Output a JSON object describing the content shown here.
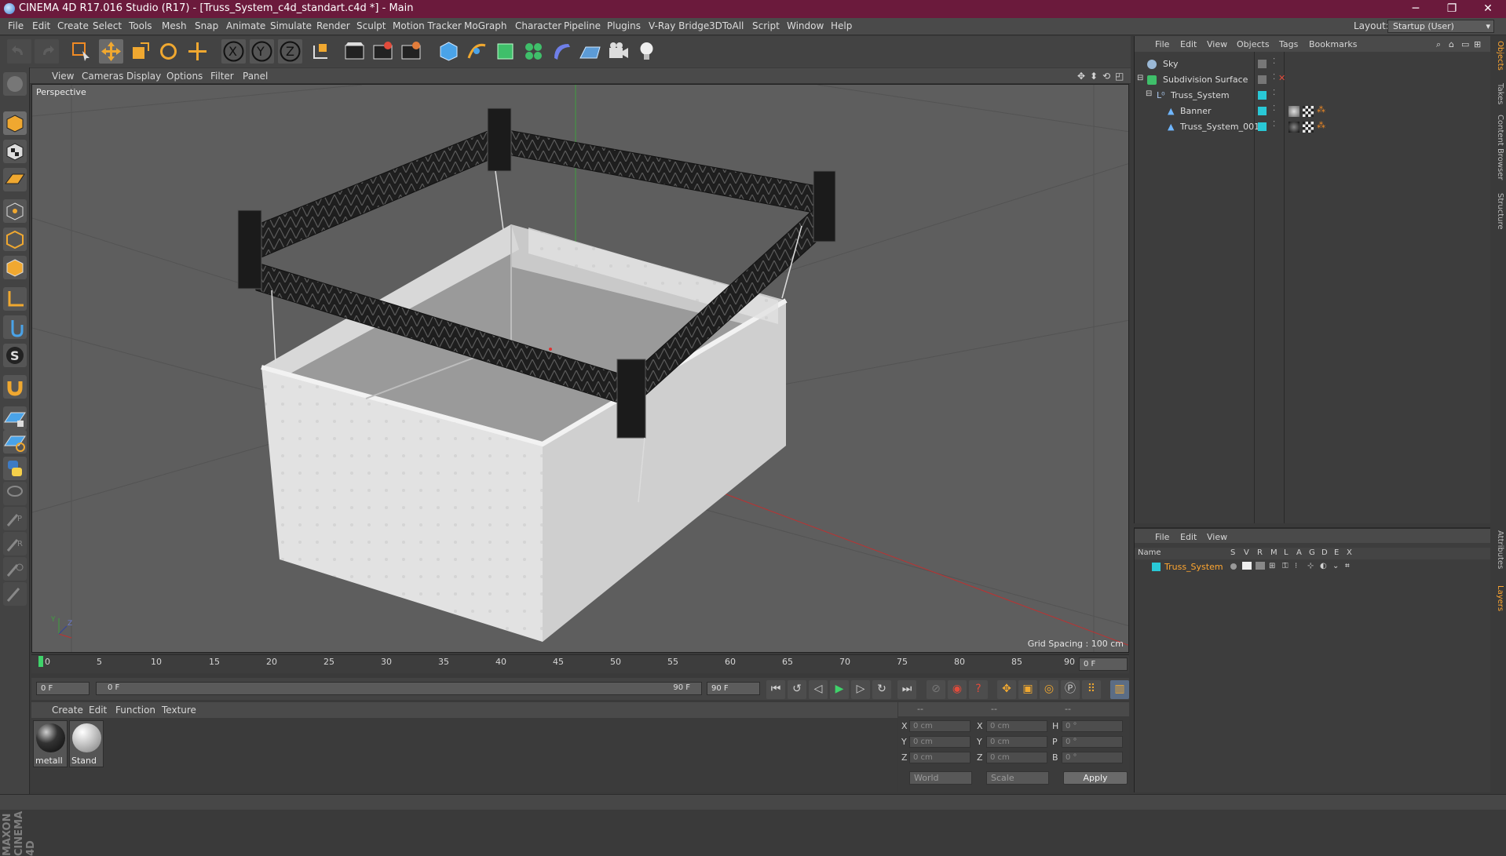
{
  "window": {
    "title": "CINEMA 4D R17.016 Studio (R17) - [Truss_System_c4d_standart.c4d *] - Main"
  },
  "menu": [
    "File",
    "Edit",
    "Create",
    "Select",
    "Tools",
    "Mesh",
    "Snap",
    "Animate",
    "Simulate",
    "Render",
    "Sculpt",
    "Motion Tracker",
    "MoGraph",
    "Character",
    "Pipeline",
    "Plugins",
    "V-Ray Bridge",
    "3DToAll",
    "Script",
    "Window",
    "Help"
  ],
  "layout": {
    "label": "Layout:",
    "value": "Startup (User)"
  },
  "viewport": {
    "menu": [
      "View",
      "Cameras",
      "Display",
      "Options",
      "Filter",
      "Panel"
    ],
    "label": "Perspective",
    "grid_spacing": "Grid Spacing : 100 cm"
  },
  "timeline": {
    "ticks": [
      "0",
      "5",
      "10",
      "15",
      "20",
      "25",
      "30",
      "35",
      "40",
      "45",
      "50",
      "55",
      "60",
      "65",
      "70",
      "75",
      "80",
      "85",
      "90"
    ],
    "current_frame": "0 F",
    "start_field": "0 F",
    "range_start": "0 F",
    "range_end": "90 F",
    "end_field": "90 F"
  },
  "materials": {
    "menu": [
      "Create",
      "Edit",
      "Function",
      "Texture"
    ],
    "items": [
      {
        "name": "metall"
      },
      {
        "name": "Stand"
      }
    ]
  },
  "coords": {
    "header": [
      "--",
      "--",
      "--"
    ],
    "rows": [
      {
        "a": "X",
        "av": "0 cm",
        "b": "X",
        "bv": "0 cm",
        "c": "H",
        "cv": "0 °"
      },
      {
        "a": "Y",
        "av": "0 cm",
        "b": "Y",
        "bv": "0 cm",
        "c": "P",
        "cv": "0 °"
      },
      {
        "a": "Z",
        "av": "0 cm",
        "b": "Z",
        "bv": "0 cm",
        "c": "B",
        "cv": "0 °"
      }
    ],
    "world": "World",
    "scale": "Scale",
    "apply": "Apply"
  },
  "objects": {
    "menu": [
      "File",
      "Edit",
      "View",
      "Objects",
      "Tags",
      "Bookmarks"
    ],
    "rows": [
      {
        "name": "Sky"
      },
      {
        "name": "Subdivision Surface"
      },
      {
        "name": "Truss_System"
      },
      {
        "name": "Banner"
      },
      {
        "name": "Truss_System_001"
      }
    ]
  },
  "layers": {
    "menu": [
      "File",
      "Edit",
      "View"
    ],
    "headers": [
      "Name",
      "S",
      "V",
      "R",
      "M",
      "L",
      "A",
      "G",
      "D",
      "E",
      "X"
    ],
    "rows": [
      {
        "name": "Truss_System"
      }
    ],
    "accent": "#ffa630",
    "layer_color": "#29c8d6"
  },
  "side_tabs": [
    "Objects",
    "Takes",
    "Content Browser",
    "Structure",
    "Attributes",
    "Layers"
  ],
  "branding": "MAXON CINEMA 4D"
}
